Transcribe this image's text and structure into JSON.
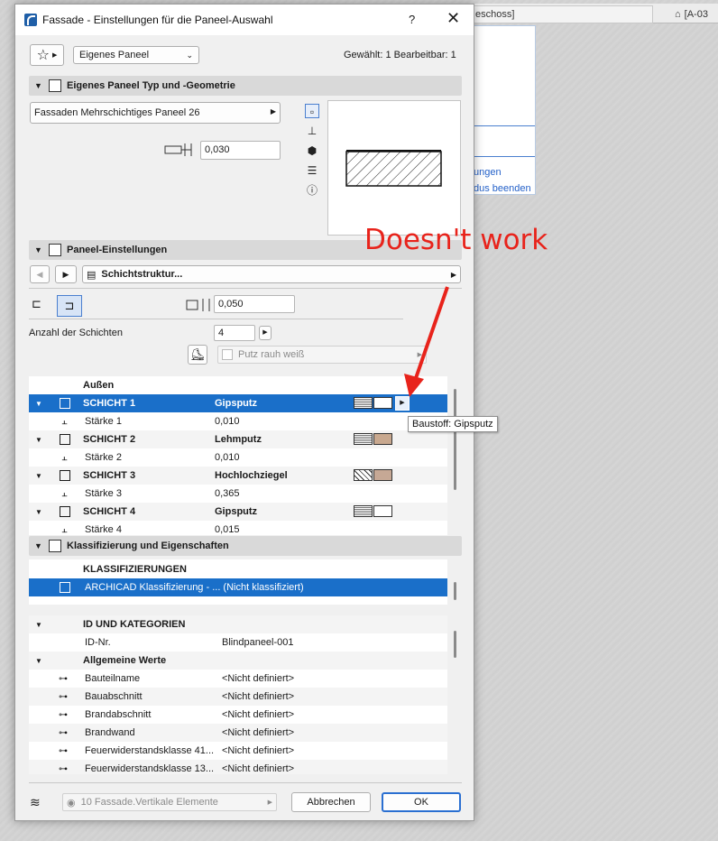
{
  "background": {
    "tab1_label": "eschoss]",
    "tab2_label": "[A-03",
    "links": [
      "ungen",
      "dus beenden"
    ]
  },
  "dialog": {
    "title": "Fassade - Einstellungen für die Paneel-Auswahl",
    "help_glyph": "?",
    "close_glyph": "✕",
    "favorites_glyph": "☆",
    "panel_dropdown": "Eigenes Paneel",
    "selection_status": "Gewählt: 1 Bearbeitbar: 1"
  },
  "section_geometry": {
    "title": "Eigenes Paneel Typ und -Geometrie",
    "panel_type": "Fassaden Mehrschichtiges Paneel 26",
    "thickness": "0,030"
  },
  "section_panel": {
    "title": "Paneel-Einstellungen",
    "page_label": "Schichtstruktur...",
    "offset": "0,050",
    "layer_count_label": "Anzahl der Schichten",
    "layer_count": "4",
    "material_placeholder": "Putz rauh weiß"
  },
  "layers_table": {
    "outside_label": "Außen",
    "rows": [
      {
        "name": "SCHICHT   1",
        "value": "Gipsputz",
        "kind": "layer",
        "selected": true
      },
      {
        "name": "Stärke   1",
        "value": "0,010",
        "kind": "thickness"
      },
      {
        "name": "SCHICHT   2",
        "value": "Lehmputz",
        "kind": "layer"
      },
      {
        "name": "Stärke   2",
        "value": "0,010",
        "kind": "thickness"
      },
      {
        "name": "SCHICHT   3",
        "value": "Hochlochziegel",
        "kind": "layer"
      },
      {
        "name": "Stärke   3",
        "value": "0,365",
        "kind": "thickness"
      },
      {
        "name": "SCHICHT   4",
        "value": "Gipsputz",
        "kind": "layer"
      },
      {
        "name": "Stärke   4",
        "value": "0,015",
        "kind": "thickness"
      }
    ],
    "swatch_colors": {
      "gipsputz": "#ffffff",
      "lehmputz": "#c8a88f",
      "ziegel": "#c6a895"
    }
  },
  "tooltip": "Baustoff: Gipsputz",
  "annotation": "Doesn't work",
  "section_classification": {
    "title": "Klassifizierung und Eigenschaften",
    "class_header": "KLASSIFIZIERUNGEN",
    "class_row": "ARCHICAD Klassifizierung - ... (Nicht klassifiziert)",
    "id_header": "ID UND KATEGORIEN",
    "id_label": "ID-Nr.",
    "id_value": "Blindpaneel-001",
    "general_header": "Allgemeine Werte",
    "properties": [
      {
        "name": "Bauteilname",
        "value": "<Nicht definiert>"
      },
      {
        "name": "Bauabschnitt",
        "value": "<Nicht definiert>"
      },
      {
        "name": "Brandabschnitt",
        "value": "<Nicht definiert>"
      },
      {
        "name": "Brandwand",
        "value": "<Nicht definiert>"
      },
      {
        "name": "Feuerwiderstandsklasse 41...",
        "value": "<Nicht definiert>"
      },
      {
        "name": "Feuerwiderstandsklasse 13...",
        "value": "<Nicht definiert>"
      }
    ]
  },
  "footer": {
    "layer_dropdown": "10 Fassade.Vertikale Elemente",
    "cancel": "Abbrechen",
    "ok": "OK"
  },
  "colors": {
    "selection": "#1a6fc9",
    "annotation": "#e8231b"
  }
}
